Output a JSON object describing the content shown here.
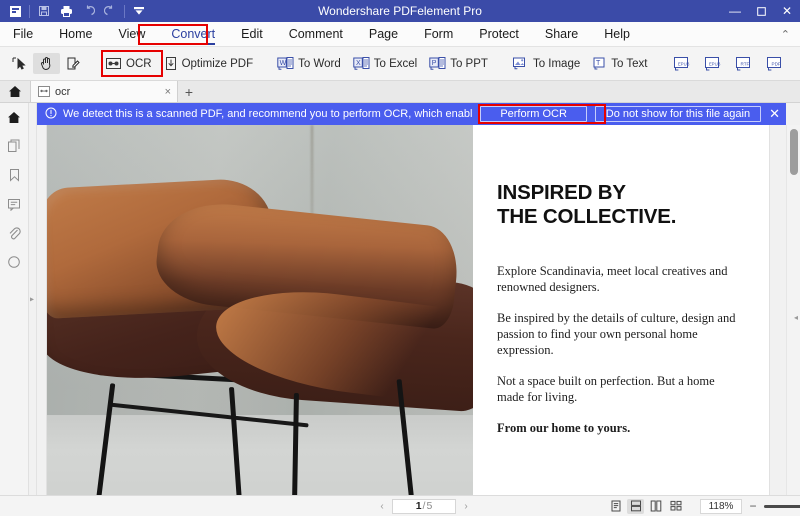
{
  "titlebar": {
    "app_title": "Wondershare PDFelement Pro",
    "quick_access": [
      {
        "name": "app-logo-icon",
        "glyph": "logo"
      },
      {
        "name": "save-icon",
        "glyph": "save"
      },
      {
        "name": "print-icon",
        "glyph": "print"
      },
      {
        "name": "undo-icon",
        "glyph": "undo"
      },
      {
        "name": "redo-icon",
        "glyph": "redo"
      },
      {
        "name": "customize-toolbar-icon",
        "glyph": "caret"
      }
    ],
    "window_controls": {
      "minimize": "—",
      "maximize": "☐",
      "close": "✕"
    }
  },
  "menubar": {
    "items": [
      {
        "label": "File",
        "active": false
      },
      {
        "label": "Home",
        "active": false
      },
      {
        "label": "View",
        "active": false
      },
      {
        "label": "Convert",
        "active": true
      },
      {
        "label": "Edit",
        "active": false
      },
      {
        "label": "Comment",
        "active": false
      },
      {
        "label": "Page",
        "active": false
      },
      {
        "label": "Form",
        "active": false
      },
      {
        "label": "Protect",
        "active": false
      },
      {
        "label": "Share",
        "active": false
      },
      {
        "label": "Help",
        "active": false
      }
    ],
    "collapse_glyph": "⌃"
  },
  "ribbon": {
    "tools": [
      {
        "label": "",
        "name": "select-tool",
        "icon": "cursor-icon",
        "selected": false
      },
      {
        "label": "",
        "name": "hand-tool",
        "icon": "hand-icon",
        "selected": true
      },
      {
        "label": "",
        "name": "edit-tool",
        "icon": "pencil-page-icon",
        "selected": false
      }
    ],
    "convert_tools": [
      {
        "label": "OCR",
        "name": "ocr-button",
        "icon": "ocr-icon",
        "highlighted": true
      },
      {
        "label": "Optimize PDF",
        "name": "optimize-pdf-button",
        "icon": "optimize-icon"
      },
      {
        "label": "To Word",
        "name": "to-word-button",
        "icon": "word-icon"
      },
      {
        "label": "To Excel",
        "name": "to-excel-button",
        "icon": "excel-icon"
      },
      {
        "label": "To PPT",
        "name": "to-ppt-button",
        "icon": "ppt-icon"
      },
      {
        "label": "To Image",
        "name": "to-image-button",
        "icon": "image-icon"
      },
      {
        "label": "To Text",
        "name": "to-text-button",
        "icon": "text-icon"
      }
    ],
    "format_tools": [
      {
        "label": "EPUB",
        "name": "to-epub-button"
      },
      {
        "label": "EPUB",
        "name": "to-epub2-button"
      },
      {
        "label": "RTF",
        "name": "to-rtf-button"
      },
      {
        "label": "PDF",
        "name": "to-pdf-button"
      }
    ]
  },
  "tabstrip": {
    "home_icon": "home-icon",
    "tabs": [
      {
        "label": "ocr",
        "close": "×",
        "icon": "pdf-file-icon"
      }
    ],
    "new_tab": "+"
  },
  "leftrail": {
    "items": [
      {
        "name": "sidebar-home-icon",
        "icon": "home"
      },
      {
        "name": "sidebar-thumbnails-icon",
        "icon": "pages"
      },
      {
        "name": "sidebar-bookmarks-icon",
        "icon": "bookmark"
      },
      {
        "name": "sidebar-comments-icon",
        "icon": "comment"
      },
      {
        "name": "sidebar-attachments-icon",
        "icon": "paperclip"
      },
      {
        "name": "sidebar-stamp-icon",
        "icon": "circle"
      }
    ]
  },
  "notification": {
    "icon": "info-icon",
    "message": "We detect this is a scanned PDF, and recommend you to perform OCR, which enables you to ...",
    "perform_label": "Perform OCR",
    "dismiss_label": "Do not show for this file again",
    "close_glyph": "✕",
    "accent_color": "#4a5dee",
    "highlight_color": "#e60000"
  },
  "document": {
    "heading_line1": "INSPIRED BY",
    "heading_line2": "THE COLLECTIVE.",
    "paragraphs": [
      "Explore Scandinavia, meet local creatives and renowned designers.",
      "Be inspired by the details of culture, design and passion to find your own personal home expression.",
      "Not a space built on perfection. But a home made for living."
    ],
    "closing": "From our home to yours.",
    "photo_alt": "tan-and-brown-armchair-photo"
  },
  "statusbar": {
    "prev_glyph": "‹",
    "next_glyph": "›",
    "current_page": "1",
    "page_separator": "/",
    "total_pages": "5",
    "view_modes": [
      {
        "name": "single-page-view",
        "selected": false
      },
      {
        "name": "continuous-scroll-view",
        "selected": true
      },
      {
        "name": "two-page-view",
        "selected": false
      },
      {
        "name": "thumbnail-grid-view",
        "selected": false
      }
    ],
    "zoom_level": "118%",
    "zoom_minus": "−",
    "zoom_plus": "+"
  }
}
